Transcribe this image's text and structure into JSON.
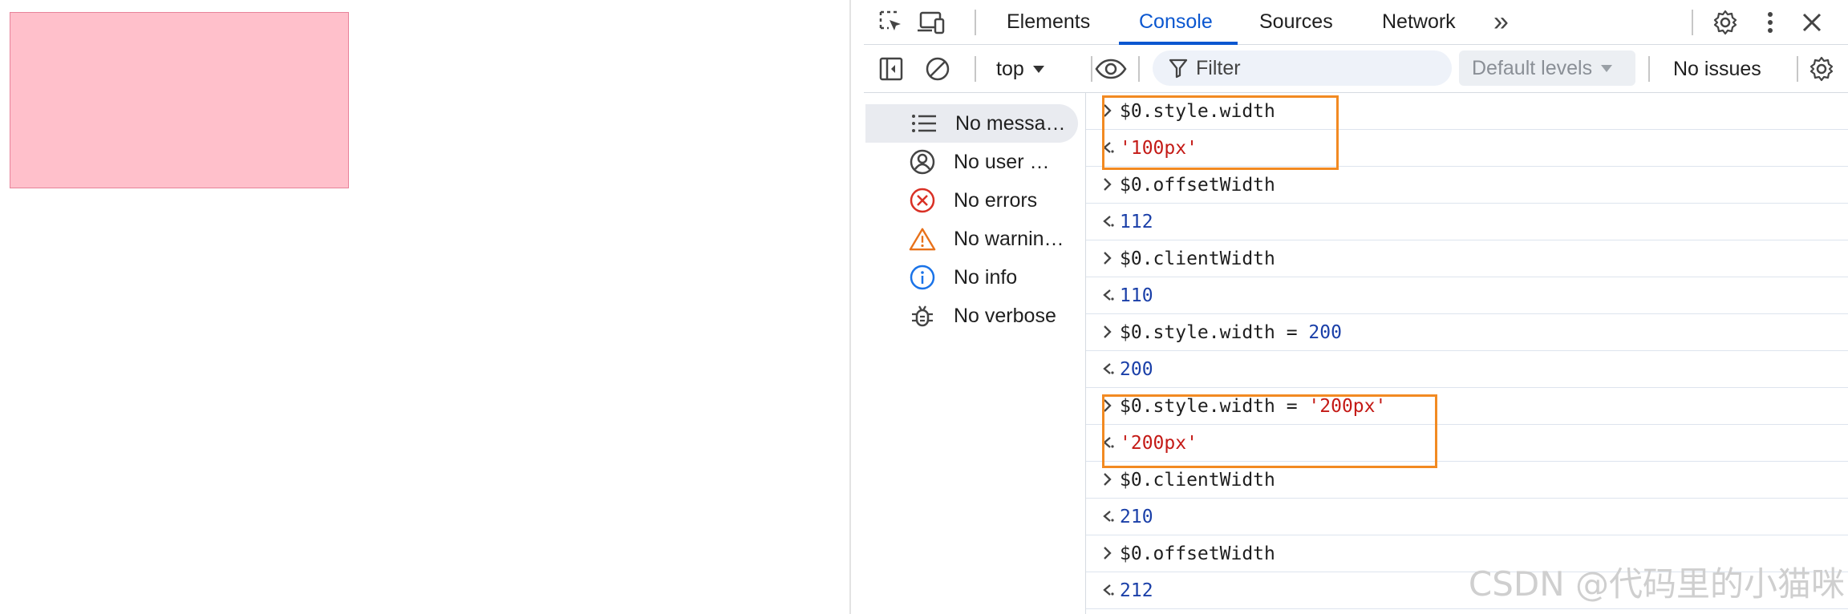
{
  "devtools": {
    "tabs": [
      {
        "label": "Elements"
      },
      {
        "label": "Console"
      },
      {
        "label": "Sources"
      },
      {
        "label": "Network"
      }
    ],
    "more_tabs_glyph": "»",
    "active_color": "#0b57d0"
  },
  "toolbar": {
    "context": "top",
    "filter_placeholder": "Filter",
    "levels": "Default levels",
    "issues": "No issues"
  },
  "sidebar": {
    "items": [
      {
        "label": "No messa…",
        "icon": "list-icon"
      },
      {
        "label": "No user …",
        "icon": "user-icon"
      },
      {
        "label": "No errors",
        "icon": "error-icon"
      },
      {
        "label": "No warnin…",
        "icon": "warning-icon"
      },
      {
        "label": "No info",
        "icon": "info-icon"
      },
      {
        "label": "No verbose",
        "icon": "bug-icon"
      }
    ]
  },
  "console": {
    "entries": [
      {
        "input": "$0.style.width",
        "output": "'100px'",
        "output_type": "string"
      },
      {
        "input": "$0.offsetWidth",
        "output": "112",
        "output_type": "number"
      },
      {
        "input": "$0.clientWidth",
        "output": "110",
        "output_type": "number"
      },
      {
        "input": "$0.style.width = ",
        "input_value": "200",
        "input_value_type": "number",
        "output": "200",
        "output_type": "number"
      },
      {
        "input": "$0.style.width = ",
        "input_value": "'200px'",
        "input_value_type": "string",
        "output": "'200px'",
        "output_type": "string"
      },
      {
        "input": "$0.clientWidth",
        "output": "210",
        "output_type": "number"
      },
      {
        "input": "$0.offsetWidth",
        "output": "212",
        "output_type": "number"
      }
    ]
  },
  "colors": {
    "box_fill": "#ffc0cb",
    "highlight": "#f28a22",
    "string": "#c41a16",
    "number": "#1a3fa8"
  },
  "watermark": "CSDN @代码里的小猫咪"
}
